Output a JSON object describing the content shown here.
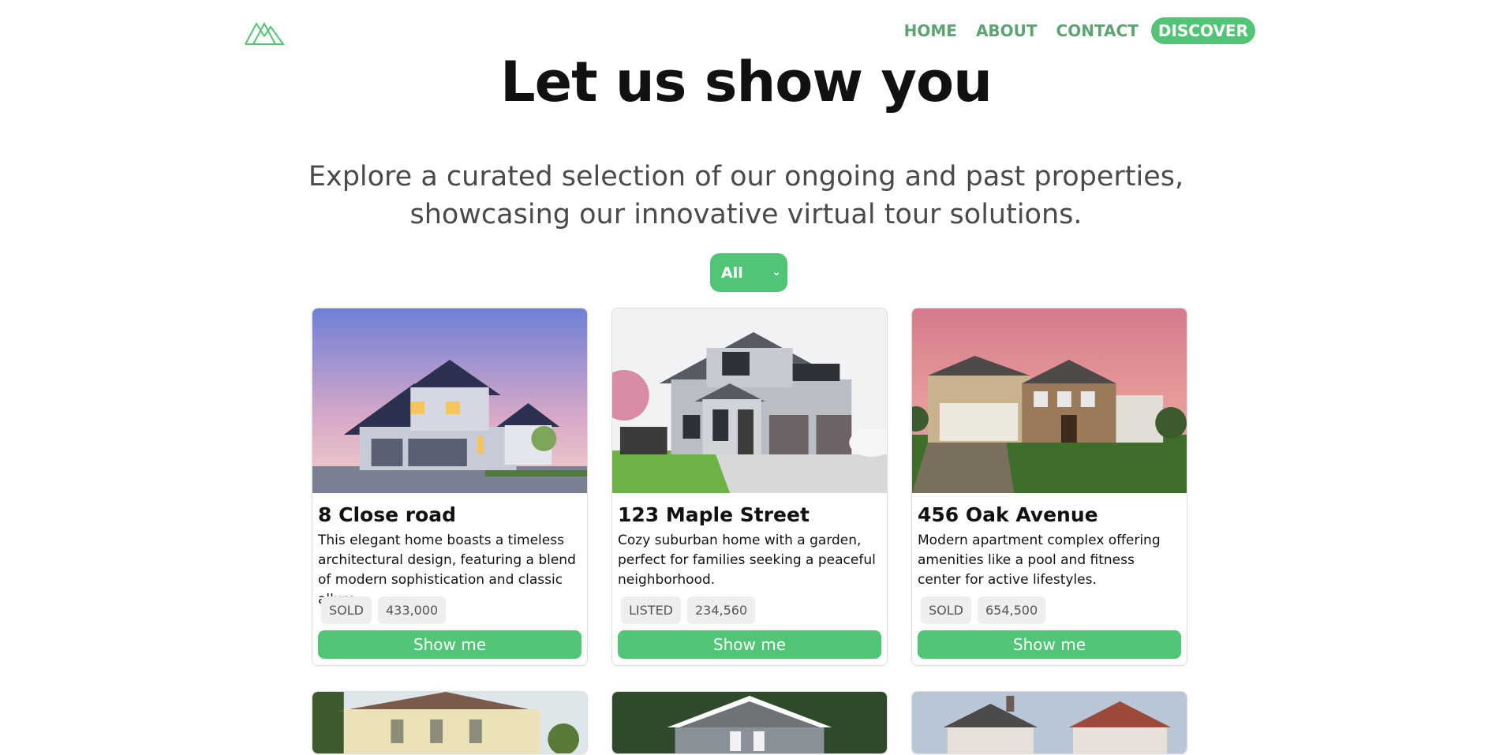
{
  "nav": {
    "links": [
      {
        "label": "HOME"
      },
      {
        "label": "ABOUT"
      },
      {
        "label": "CONTACT"
      }
    ],
    "cta_label": "DISCOVER",
    "logo_icon": "mountain-logo-icon",
    "accent_color": "#52c475"
  },
  "hero": {
    "title": "Let us show you",
    "subtitle": "Explore a curated selection of our ongoing and past properties, showcasing our innovative virtual tour solutions."
  },
  "filter": {
    "selected": "All"
  },
  "properties": [
    {
      "title": "8 Close road",
      "description": "This elegant home boasts a timeless architectural design, featuring a blend of modern sophistication and classic allure.",
      "status": "SOLD",
      "price": "433,000",
      "button_label": "Show me"
    },
    {
      "title": "123 Maple Street",
      "description": "Cozy suburban home with a garden, perfect for families seeking a peaceful neighborhood.",
      "status": "LISTED",
      "price": "234,560",
      "button_label": "Show me"
    },
    {
      "title": "456 Oak Avenue",
      "description": "Modern apartment complex offering amenities like a pool and fitness center for active lifestyles.",
      "status": "SOLD",
      "price": "654,500",
      "button_label": "Show me"
    }
  ]
}
